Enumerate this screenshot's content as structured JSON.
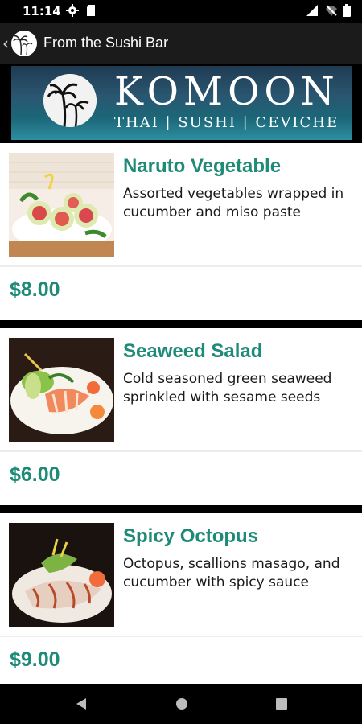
{
  "status_bar": {
    "time": "11:14"
  },
  "app_bar": {
    "title": "From the Sushi Bar"
  },
  "banner": {
    "brand": "KOMOON",
    "tagline": "THAI | SUSHI | CEVICHE"
  },
  "menu_items": [
    {
      "name": "Naruto Vegetable",
      "description": "Assorted vegetables wrapped in cucumber and miso paste",
      "price": "$8.00"
    },
    {
      "name": "Seaweed Salad",
      "description": "Cold seasoned green seaweed sprinkled with sesame seeds",
      "price": "$6.00"
    },
    {
      "name": "Spicy Octopus",
      "description": "Octopus, scallions masago, and cucumber with spicy sauce",
      "price": "$9.00"
    }
  ],
  "colors": {
    "accent": "#1e8a78",
    "banner": "#2a5670"
  }
}
